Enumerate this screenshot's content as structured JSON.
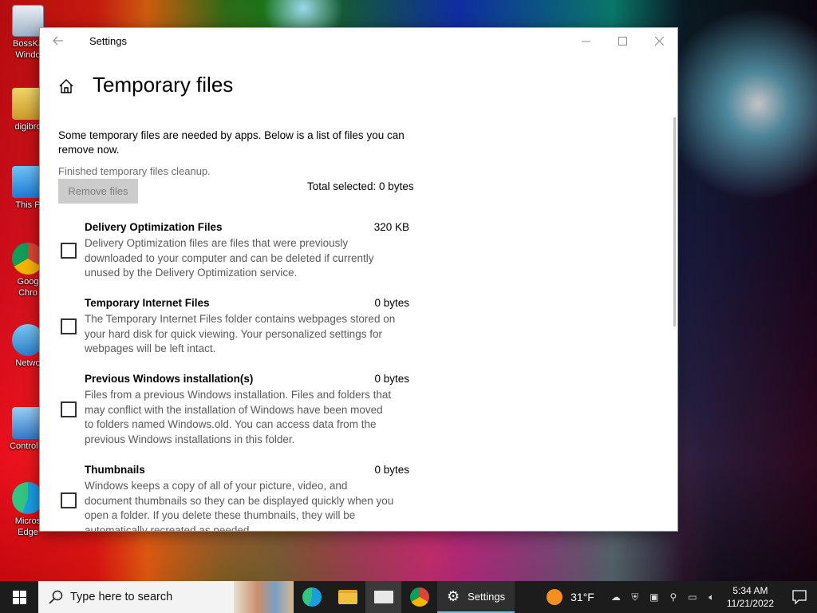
{
  "desktop": {
    "icons": [
      {
        "label": "BossKa\nWindo"
      },
      {
        "label": "digibro"
      },
      {
        "label": "This P"
      },
      {
        "label": "Goog\nChro"
      },
      {
        "label": "Netwo"
      },
      {
        "label": "Control P"
      },
      {
        "label": "Micros\nEdge"
      }
    ]
  },
  "window": {
    "title": "Settings",
    "page_title": "Temporary files",
    "intro": "Some temporary files are needed by apps. Below is a list of files you can remove now.",
    "status": "Finished temporary files cleanup.",
    "remove_button": "Remove files",
    "total_selected": "Total selected: 0 bytes",
    "items": [
      {
        "name": "Delivery Optimization Files",
        "size": "320 KB",
        "checked": false,
        "desc": "Delivery Optimization files are files that were previously\ndownloaded to your computer and can be deleted if currently\nunused by the Delivery Optimization service."
      },
      {
        "name": "Temporary Internet Files",
        "size": "0 bytes",
        "checked": false,
        "desc": "The Temporary Internet Files folder contains webpages stored on\nyour hard disk for quick viewing. Your personalized settings for\nwebpages will be left intact."
      },
      {
        "name": "Previous Windows installation(s)",
        "size": "0 bytes",
        "checked": false,
        "desc": "Files from a previous Windows installation.  Files and folders that\nmay conflict with the installation of Windows have been moved\nto folders named Windows.old.  You can access data from the\nprevious Windows installations in this folder."
      },
      {
        "name": "Thumbnails",
        "size": "0 bytes",
        "checked": false,
        "desc": "Windows keeps a copy of all of your picture, video, and\ndocument thumbnails so they can be displayed quickly when you\nopen a folder. If you delete these thumbnails, they will be\nautomatically recreated as needed."
      }
    ]
  },
  "taskbar": {
    "search_placeholder": "Type here to search",
    "settings_app": "Settings",
    "temperature": "31°F",
    "time": "5:34 AM",
    "date": "11/21/2022"
  },
  "colors": {
    "accent": "#76b9ed",
    "taskbar_bg": "#1c1c1c",
    "button_disabled_bg": "#cccccc"
  }
}
